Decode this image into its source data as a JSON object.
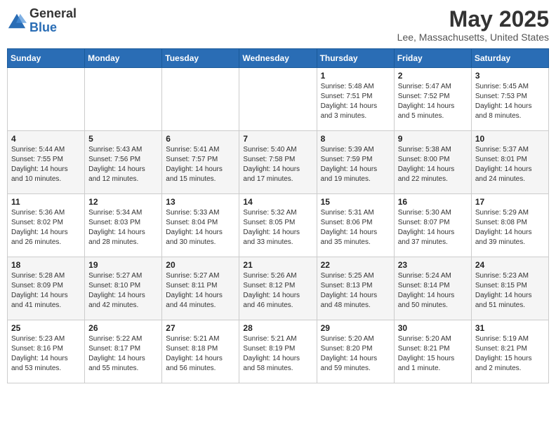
{
  "header": {
    "logo_general": "General",
    "logo_blue": "Blue",
    "month_title": "May 2025",
    "location": "Lee, Massachusetts, United States"
  },
  "days_of_week": [
    "Sunday",
    "Monday",
    "Tuesday",
    "Wednesday",
    "Thursday",
    "Friday",
    "Saturday"
  ],
  "weeks": [
    [
      {
        "day": "",
        "empty": true
      },
      {
        "day": "",
        "empty": true
      },
      {
        "day": "",
        "empty": true
      },
      {
        "day": "",
        "empty": true
      },
      {
        "day": "1",
        "sunrise": "5:48 AM",
        "sunset": "7:51 PM",
        "daylight": "14 hours and 3 minutes."
      },
      {
        "day": "2",
        "sunrise": "5:47 AM",
        "sunset": "7:52 PM",
        "daylight": "14 hours and 5 minutes."
      },
      {
        "day": "3",
        "sunrise": "5:45 AM",
        "sunset": "7:53 PM",
        "daylight": "14 hours and 8 minutes."
      }
    ],
    [
      {
        "day": "4",
        "sunrise": "5:44 AM",
        "sunset": "7:55 PM",
        "daylight": "14 hours and 10 minutes."
      },
      {
        "day": "5",
        "sunrise": "5:43 AM",
        "sunset": "7:56 PM",
        "daylight": "14 hours and 12 minutes."
      },
      {
        "day": "6",
        "sunrise": "5:41 AM",
        "sunset": "7:57 PM",
        "daylight": "14 hours and 15 minutes."
      },
      {
        "day": "7",
        "sunrise": "5:40 AM",
        "sunset": "7:58 PM",
        "daylight": "14 hours and 17 minutes."
      },
      {
        "day": "8",
        "sunrise": "5:39 AM",
        "sunset": "7:59 PM",
        "daylight": "14 hours and 19 minutes."
      },
      {
        "day": "9",
        "sunrise": "5:38 AM",
        "sunset": "8:00 PM",
        "daylight": "14 hours and 22 minutes."
      },
      {
        "day": "10",
        "sunrise": "5:37 AM",
        "sunset": "8:01 PM",
        "daylight": "14 hours and 24 minutes."
      }
    ],
    [
      {
        "day": "11",
        "sunrise": "5:36 AM",
        "sunset": "8:02 PM",
        "daylight": "14 hours and 26 minutes."
      },
      {
        "day": "12",
        "sunrise": "5:34 AM",
        "sunset": "8:03 PM",
        "daylight": "14 hours and 28 minutes."
      },
      {
        "day": "13",
        "sunrise": "5:33 AM",
        "sunset": "8:04 PM",
        "daylight": "14 hours and 30 minutes."
      },
      {
        "day": "14",
        "sunrise": "5:32 AM",
        "sunset": "8:05 PM",
        "daylight": "14 hours and 33 minutes."
      },
      {
        "day": "15",
        "sunrise": "5:31 AM",
        "sunset": "8:06 PM",
        "daylight": "14 hours and 35 minutes."
      },
      {
        "day": "16",
        "sunrise": "5:30 AM",
        "sunset": "8:07 PM",
        "daylight": "14 hours and 37 minutes."
      },
      {
        "day": "17",
        "sunrise": "5:29 AM",
        "sunset": "8:08 PM",
        "daylight": "14 hours and 39 minutes."
      }
    ],
    [
      {
        "day": "18",
        "sunrise": "5:28 AM",
        "sunset": "8:09 PM",
        "daylight": "14 hours and 41 minutes."
      },
      {
        "day": "19",
        "sunrise": "5:27 AM",
        "sunset": "8:10 PM",
        "daylight": "14 hours and 42 minutes."
      },
      {
        "day": "20",
        "sunrise": "5:27 AM",
        "sunset": "8:11 PM",
        "daylight": "14 hours and 44 minutes."
      },
      {
        "day": "21",
        "sunrise": "5:26 AM",
        "sunset": "8:12 PM",
        "daylight": "14 hours and 46 minutes."
      },
      {
        "day": "22",
        "sunrise": "5:25 AM",
        "sunset": "8:13 PM",
        "daylight": "14 hours and 48 minutes."
      },
      {
        "day": "23",
        "sunrise": "5:24 AM",
        "sunset": "8:14 PM",
        "daylight": "14 hours and 50 minutes."
      },
      {
        "day": "24",
        "sunrise": "5:23 AM",
        "sunset": "8:15 PM",
        "daylight": "14 hours and 51 minutes."
      }
    ],
    [
      {
        "day": "25",
        "sunrise": "5:23 AM",
        "sunset": "8:16 PM",
        "daylight": "14 hours and 53 minutes."
      },
      {
        "day": "26",
        "sunrise": "5:22 AM",
        "sunset": "8:17 PM",
        "daylight": "14 hours and 55 minutes."
      },
      {
        "day": "27",
        "sunrise": "5:21 AM",
        "sunset": "8:18 PM",
        "daylight": "14 hours and 56 minutes."
      },
      {
        "day": "28",
        "sunrise": "5:21 AM",
        "sunset": "8:19 PM",
        "daylight": "14 hours and 58 minutes."
      },
      {
        "day": "29",
        "sunrise": "5:20 AM",
        "sunset": "8:20 PM",
        "daylight": "14 hours and 59 minutes."
      },
      {
        "day": "30",
        "sunrise": "5:20 AM",
        "sunset": "8:21 PM",
        "daylight": "15 hours and 1 minute."
      },
      {
        "day": "31",
        "sunrise": "5:19 AM",
        "sunset": "8:21 PM",
        "daylight": "15 hours and 2 minutes."
      }
    ]
  ],
  "labels": {
    "sunrise_prefix": "Sunrise: ",
    "sunset_prefix": "Sunset: ",
    "daylight_prefix": "Daylight: "
  }
}
